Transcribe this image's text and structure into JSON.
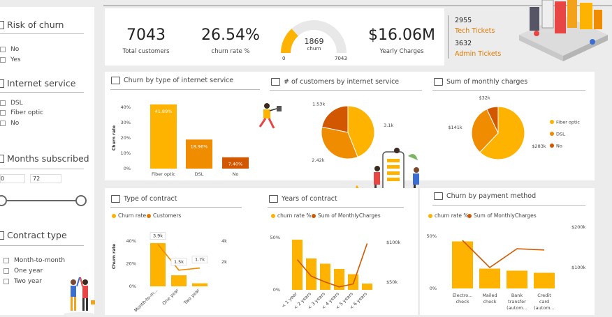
{
  "colors": {
    "accent": "#fdb300",
    "dark_orange": "#d15700",
    "mid_orange": "#ef8c00"
  },
  "filters": {
    "risk": {
      "title": "Risk of churn",
      "options": [
        "No",
        "Yes"
      ]
    },
    "internet": {
      "title": "Internet service",
      "options": [
        "DSL",
        "Fiber optic",
        "No"
      ]
    },
    "months": {
      "title": "Months subscribed",
      "min": "0",
      "max": "72"
    },
    "contract": {
      "title": "Contract type",
      "options": [
        "Month-to-month",
        "One year",
        "Two year"
      ]
    }
  },
  "kpis": {
    "customers": {
      "value": "7043",
      "label": "Total customers"
    },
    "churn_rate": {
      "value": "26.54%",
      "label": "churn rate %"
    },
    "gauge": {
      "value": "1869",
      "label": "churn",
      "min": "0",
      "max": "7043",
      "fraction": 0.265
    },
    "charges": {
      "value": "$16.06M",
      "label": "Yearly Charges"
    },
    "tickets": {
      "tech_count": "2955",
      "tech_label": "Tech Tickets",
      "admin_count": "3632",
      "admin_label": "Admin Tickets"
    }
  },
  "panels": {
    "p1_title": "Churn by type of internet service",
    "p2_title": "# of customers by internet service",
    "p3_title": "Sum of monthly charges",
    "p4_title": "Type of contract",
    "p5_title": "Years of contract",
    "p6_title": "Churn by payment method"
  },
  "chart_data": [
    {
      "type": "bar",
      "ylabel": "Churn rate",
      "categories": [
        "Fiber optic",
        "DSL",
        "No"
      ],
      "values": [
        41.89,
        18.96,
        7.4
      ],
      "data_labels": [
        "41.89%",
        "18.96%",
        "7.40%"
      ],
      "ylim": [
        0,
        40
      ],
      "ticks": [
        "0%",
        "10%",
        "20%",
        "30%",
        "40%"
      ]
    },
    {
      "type": "pie",
      "labels": [
        "3.1k",
        "2.42k",
        "1.53k"
      ],
      "values": [
        3.1,
        2.42,
        1.53
      ],
      "colors": [
        "#fdb300",
        "#ef8c00",
        "#d15700"
      ]
    },
    {
      "type": "pie",
      "labels": [
        "$283k",
        "$141k",
        "$32k"
      ],
      "values": [
        283,
        141,
        32
      ],
      "legend": [
        "Fiber optic",
        "DSL",
        "No"
      ],
      "colors": [
        "#fdb300",
        "#ef8c00",
        "#d15700"
      ]
    },
    {
      "type": "bar",
      "ylabel": "Churn rate",
      "legend": [
        "Churn rate",
        "Customers"
      ],
      "categories": [
        "Month-to-m...",
        "One year",
        "Two year"
      ],
      "churn": [
        43,
        11,
        3
      ],
      "customers": [
        3.9,
        1.5,
        1.7
      ],
      "data_labels": [
        "3.9k",
        "1.5k",
        "1.7k"
      ],
      "ylim": [
        0,
        40
      ],
      "yticks": [
        "0%",
        "20%",
        "40%"
      ],
      "y2ticks": [
        "2k",
        "4k"
      ]
    },
    {
      "type": "bar",
      "legend": [
        "churn rate %",
        "Sum of MonthlyCharges"
      ],
      "categories": [
        "< 1 year",
        "< 2 years",
        "< 3 years",
        "< 4 years",
        "< 5 years",
        "< 6 years"
      ],
      "churn": [
        48,
        30,
        25,
        20,
        15,
        6
      ],
      "charges": [
        62,
        28,
        16,
        6,
        12,
        95
      ],
      "yticks": [
        "0%",
        "50%"
      ],
      "y2ticks": [
        "$50k",
        "$100k"
      ]
    },
    {
      "type": "bar",
      "legend": [
        "churn rate %",
        "Sum of MonthlyCharges"
      ],
      "categories": [
        "Electro... check",
        "Mailed check",
        "Bank transfer (autom...",
        "Credit card (autom..."
      ],
      "churn": [
        45,
        19,
        17,
        15
      ],
      "charges": [
        115,
        50,
        95,
        92
      ],
      "yticks": [
        "0%",
        "50%"
      ],
      "y2ticks": [
        "$100k",
        "$200k"
      ]
    }
  ]
}
